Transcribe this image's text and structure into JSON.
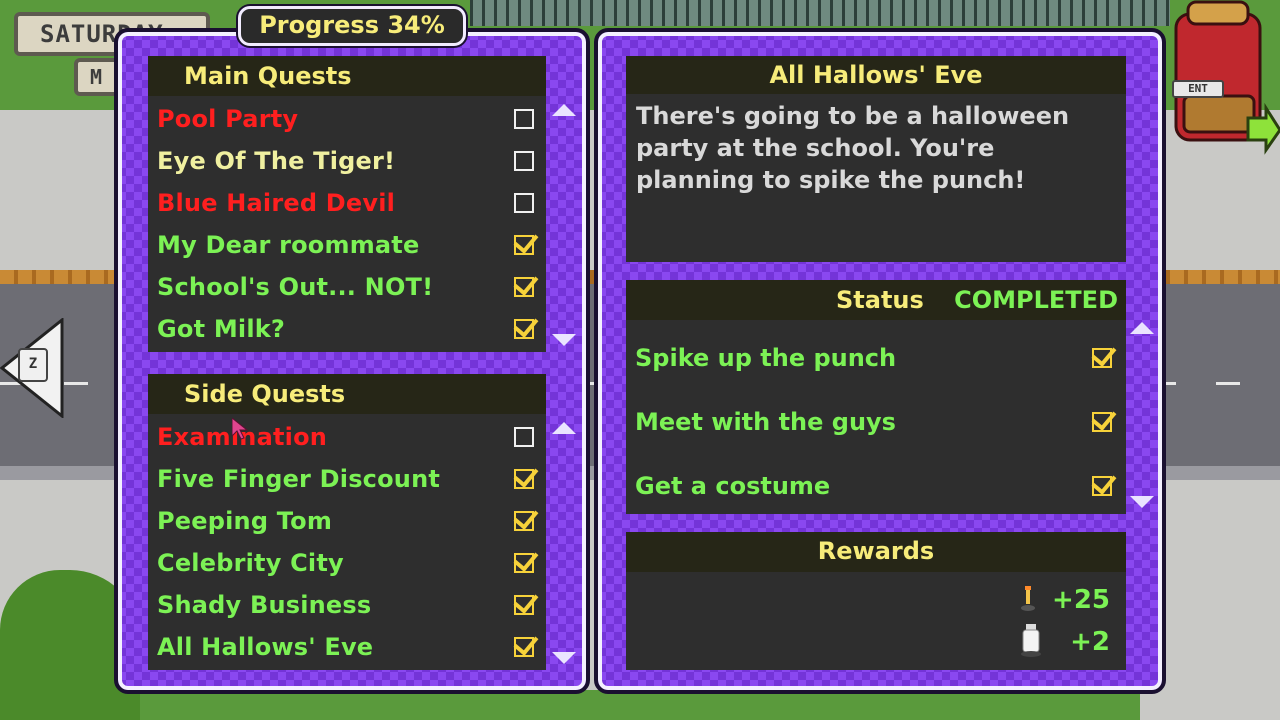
{
  "background": {
    "day_sign": "SATURDAY",
    "day_sign_small": "M",
    "left_key": "Z",
    "backpack_key": "ENT"
  },
  "progress": {
    "label": "Progress 34%",
    "percent": 34
  },
  "main_quests": {
    "title": "Main Quests",
    "items": [
      {
        "name": "Pool Party",
        "state": "incomplete",
        "checked": false
      },
      {
        "name": "Eye Of The Tiger!",
        "state": "neutral",
        "checked": false
      },
      {
        "name": "Blue Haired Devil",
        "state": "incomplete",
        "checked": false
      },
      {
        "name": "My Dear roommate",
        "state": "complete",
        "checked": true
      },
      {
        "name": "School's Out... NOT!",
        "state": "complete",
        "checked": true
      },
      {
        "name": "Got Milk?",
        "state": "complete",
        "checked": true
      }
    ]
  },
  "side_quests": {
    "title": "Side Quests",
    "items": [
      {
        "name": "Examination",
        "state": "incomplete",
        "checked": false
      },
      {
        "name": "Five Finger Discount",
        "state": "complete",
        "checked": true
      },
      {
        "name": "Peeping Tom",
        "state": "complete",
        "checked": true
      },
      {
        "name": "Celebrity City",
        "state": "complete",
        "checked": true
      },
      {
        "name": "Shady Business",
        "state": "complete",
        "checked": true
      },
      {
        "name": "All Hallows' Eve",
        "state": "complete",
        "checked": true
      }
    ]
  },
  "detail": {
    "title": "All Hallows' Eve",
    "description": "There's going to be a halloween party at the school. You're planning to spike the punch!",
    "status_label": "Status",
    "status_value": "COMPLETED",
    "tasks": [
      {
        "name": "Spike up the punch",
        "checked": true
      },
      {
        "name": "Meet with the guys",
        "checked": true
      },
      {
        "name": "Get a costume",
        "checked": true
      }
    ],
    "rewards_title": "Rewards",
    "rewards": [
      {
        "icon": "candle-icon",
        "value": "+25"
      },
      {
        "icon": "milk-bottle-icon",
        "value": "+2"
      }
    ]
  },
  "colors": {
    "incomplete": "#ff1f1f",
    "complete": "#7cf255",
    "neutral": "#f0f0a0",
    "header": "#f7ec7a",
    "panel": "#8a48f0"
  }
}
